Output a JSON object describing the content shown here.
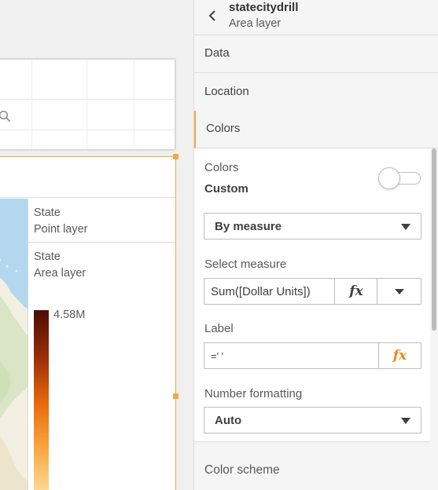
{
  "canvas": {
    "legend": {
      "items": [
        {
          "title": "State",
          "subtitle": "Point layer"
        },
        {
          "title": "State",
          "subtitle": "Area layer"
        }
      ],
      "gradient_max_label": "4.58M"
    }
  },
  "panel": {
    "title": "statecitydrill",
    "subtitle": "Area layer",
    "sections": [
      "Data",
      "Location",
      "Colors"
    ],
    "active_section": "Colors",
    "colors": {
      "mode_label": "Colors",
      "mode_value": "Custom",
      "toggle_on": false,
      "color_by": "By measure",
      "select_measure_label": "Select measure",
      "measure_value": "Sum([Dollar Units])",
      "label_label": "Label",
      "label_value": "=' '",
      "number_formatting_label": "Number formatting",
      "number_formatting_value": "Auto",
      "color_scheme_label": "Color scheme"
    },
    "fx_symbol": "fx"
  },
  "colors": {
    "accent": "#f0a94d",
    "fx_accent": "#e8891c"
  }
}
